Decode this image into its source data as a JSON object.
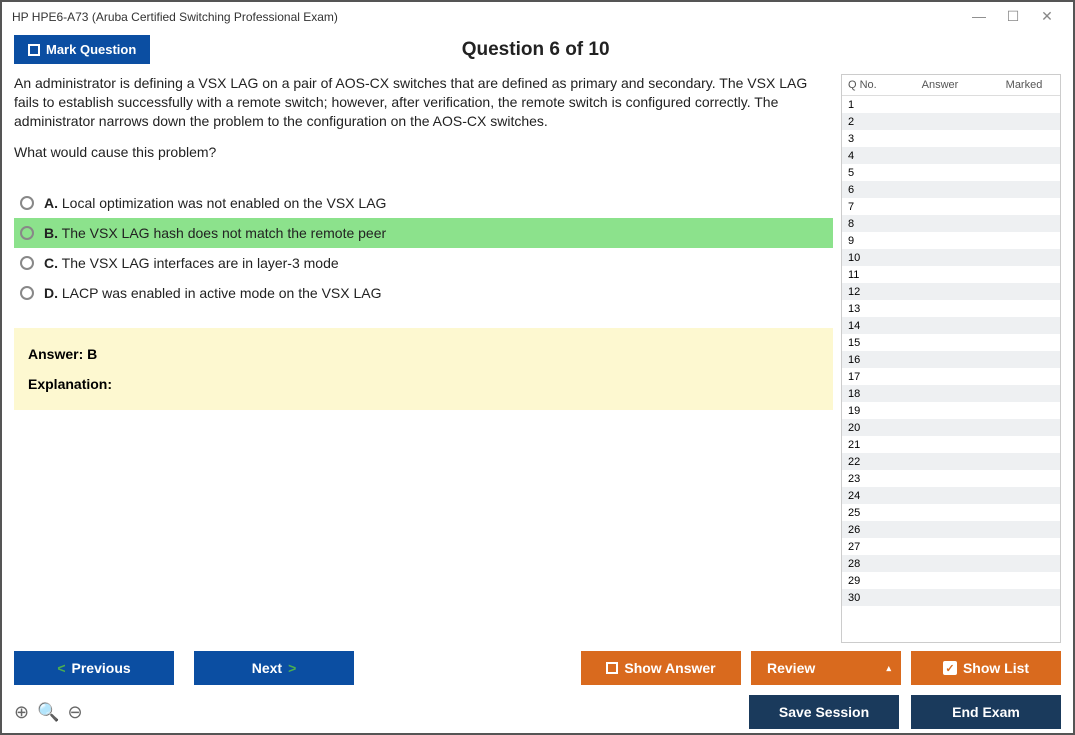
{
  "title": "HP HPE6-A73 (Aruba Certified Switching Professional Exam)",
  "mark_label": "Mark Question",
  "counter": "Question 6 of 10",
  "question": {
    "para1": "An administrator is defining a VSX LAG on a pair of AOS-CX switches that are defined as primary and secondary. The VSX LAG fails to establish successfully with a remote switch; however, after verification, the remote switch is configured correctly. The administrator narrows down the problem to the configuration on the AOS-CX switches.",
    "para2": "What would cause this problem?"
  },
  "options": [
    {
      "letter": "A.",
      "text": "Local optimization was not enabled on the VSX LAG",
      "selected": false
    },
    {
      "letter": "B.",
      "text": "The VSX LAG hash does not match the remote peer",
      "selected": true
    },
    {
      "letter": "C.",
      "text": "The VSX LAG interfaces are in layer-3 mode",
      "selected": false
    },
    {
      "letter": "D.",
      "text": "LACP was enabled in active mode on the VSX LAG",
      "selected": false
    }
  ],
  "answer_label": "Answer: B",
  "explanation_label": "Explanation:",
  "sidebar": {
    "h1": "Q No.",
    "h2": "Answer",
    "h3": "Marked",
    "rows": [
      1,
      2,
      3,
      4,
      5,
      6,
      7,
      8,
      9,
      10,
      11,
      12,
      13,
      14,
      15,
      16,
      17,
      18,
      19,
      20,
      21,
      22,
      23,
      24,
      25,
      26,
      27,
      28,
      29,
      30
    ]
  },
  "buttons": {
    "previous": "Previous",
    "next": "Next",
    "show_answer": "Show Answer",
    "review": "Review",
    "show_list": "Show List",
    "save_session": "Save Session",
    "end_exam": "End Exam"
  }
}
